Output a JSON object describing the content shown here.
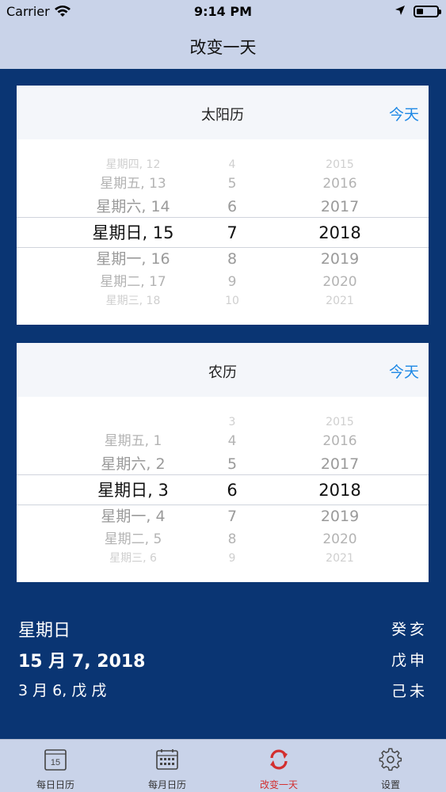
{
  "status": {
    "carrier": "Carrier",
    "time": "9:14 PM"
  },
  "nav": {
    "title": "改变一天"
  },
  "solar": {
    "title": "太阳历",
    "today": "今天",
    "rows": [
      {
        "d": "星期四, 12",
        "m": "4",
        "y": "2015"
      },
      {
        "d": "星期五, 13",
        "m": "5",
        "y": "2016"
      },
      {
        "d": "星期六, 14",
        "m": "6",
        "y": "2017"
      },
      {
        "d": "星期日, 15",
        "m": "7",
        "y": "2018"
      },
      {
        "d": "星期一, 16",
        "m": "8",
        "y": "2019"
      },
      {
        "d": "星期二, 17",
        "m": "9",
        "y": "2020"
      },
      {
        "d": "星期三, 18",
        "m": "10",
        "y": "2021"
      }
    ]
  },
  "lunar": {
    "title": "农历",
    "today": "今天",
    "rows": [
      {
        "d": "",
        "m": "3",
        "y": "2015"
      },
      {
        "d": "星期五, 1",
        "m": "4",
        "y": "2016"
      },
      {
        "d": "星期六, 2",
        "m": "5",
        "y": "2017"
      },
      {
        "d": "星期日, 3",
        "m": "6",
        "y": "2018"
      },
      {
        "d": "星期一, 4",
        "m": "7",
        "y": "2019"
      },
      {
        "d": "星期二, 5",
        "m": "8",
        "y": "2020"
      },
      {
        "d": "星期三, 6",
        "m": "9",
        "y": "2021"
      }
    ]
  },
  "info": {
    "weekday": "星期日",
    "solar_date": "15 月 7, 2018",
    "lunar_date": "3 月 6, 戊 戌",
    "ganzhi_year": "癸亥",
    "ganzhi_month": "戊申",
    "ganzhi_day": "己未"
  },
  "tabs": [
    {
      "label": "每日日历",
      "icon": "daily-calendar-icon",
      "badge": "15"
    },
    {
      "label": "每月日历",
      "icon": "monthly-calendar-icon"
    },
    {
      "label": "改变一天",
      "icon": "refresh-icon"
    },
    {
      "label": "设置",
      "icon": "gear-icon"
    }
  ],
  "colors": {
    "accent": "#1e88e5",
    "active_tab": "#d32f2f",
    "background": "#0a3573",
    "bar": "#c9d3e9"
  }
}
